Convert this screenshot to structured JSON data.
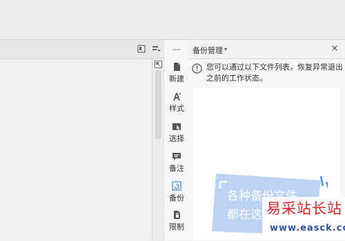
{
  "toolrail": {
    "items": [
      {
        "label": "新建",
        "icon": "new-document-icon"
      },
      {
        "label": "样式",
        "icon": "style-icon"
      },
      {
        "label": "选择",
        "icon": "select-icon"
      },
      {
        "label": "备注",
        "icon": "comment-icon"
      },
      {
        "label": "备份",
        "icon": "backup-icon"
      },
      {
        "label": "限制",
        "icon": "restrict-icon"
      }
    ]
  },
  "panel": {
    "title": "备份管理",
    "caret": "▾",
    "close": "×",
    "info": "您可以通过以下文件列表，恢复异常退出之前的工作状态。",
    "empty_state": {
      "line1": "各种备份文件",
      "line2": "都在这"
    }
  },
  "watermark": {
    "title": "易采站长站",
    "url": "www.easck.com"
  },
  "colors": {
    "accent_blue": "#4a8fe0",
    "empty_card_blue": "#bcd3f5",
    "watermark_red": "#d1262b",
    "watermark_blue": "#2b52a3"
  }
}
